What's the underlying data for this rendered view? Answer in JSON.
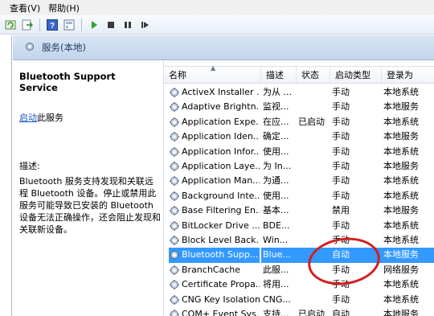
{
  "menu": {
    "items": [
      "查看(V)",
      "帮助(H)"
    ]
  },
  "toolbar": {
    "icons": [
      "refresh-icon",
      "export-icon",
      "help-icon",
      "properties-icon",
      "play-icon",
      "stop-icon",
      "pause-icon",
      "restart-icon"
    ]
  },
  "banner": {
    "title": "服务(本地)"
  },
  "description": {
    "service_name": "Bluetooth Support Service",
    "start_link": "启动",
    "start_suffix": "此服务",
    "desc_label": "描述:",
    "desc_text": "Bluetooth 服务支持发现和关联远程 Bluetooth 设备。停止或禁用此服务可能导致已安装的 Bluetooth 设备无法正确操作，还会阻止发现和关联新设备。"
  },
  "columns": {
    "name": "名称",
    "desc": "描述",
    "status": "状态",
    "start": "启动类型",
    "logon": "登录为"
  },
  "rows": [
    {
      "name": "ActiveX Installer ...",
      "desc": "为从 ...",
      "status": "",
      "start": "手动",
      "logon": "本地系统"
    },
    {
      "name": "Adaptive Brightn...",
      "desc": "监视...",
      "status": "",
      "start": "手动",
      "logon": "本地服务"
    },
    {
      "name": "Application Expe...",
      "desc": "在应...",
      "status": "已启动",
      "start": "手动",
      "logon": "本地系统"
    },
    {
      "name": "Application Iden...",
      "desc": "确定...",
      "status": "",
      "start": "手动",
      "logon": "本地服务"
    },
    {
      "name": "Application Infor...",
      "desc": "使用...",
      "status": "",
      "start": "手动",
      "logon": "本地系统"
    },
    {
      "name": "Application Laye...",
      "desc": "为 In...",
      "status": "",
      "start": "手动",
      "logon": "本地服务"
    },
    {
      "name": "Application Man...",
      "desc": "为通...",
      "status": "",
      "start": "手动",
      "logon": "本地系统"
    },
    {
      "name": "Background Inte...",
      "desc": "使用...",
      "status": "",
      "start": "手动",
      "logon": "本地系统"
    },
    {
      "name": "Base Filtering En...",
      "desc": "基本...",
      "status": "",
      "start": "禁用",
      "logon": "本地服务"
    },
    {
      "name": "BitLocker Drive ...",
      "desc": "BDE...",
      "status": "",
      "start": "手动",
      "logon": "本地系统"
    },
    {
      "name": "Block Level Back...",
      "desc": "Win...",
      "status": "",
      "start": "手动",
      "logon": "本地系统"
    },
    {
      "name": "Bluetooth Supp...",
      "desc": "Blue...",
      "status": "",
      "start": "自动",
      "logon": "本地服务",
      "selected": true
    },
    {
      "name": "BranchCache",
      "desc": "此服...",
      "status": "",
      "start": "手动",
      "logon": "网络服务"
    },
    {
      "name": "Certificate Propa...",
      "desc": "将用...",
      "status": "",
      "start": "手动",
      "logon": "本地系统"
    },
    {
      "name": "CNG Key Isolation",
      "desc": "CNG...",
      "status": "",
      "start": "手动",
      "logon": "本地系统"
    },
    {
      "name": "COM+ Event Sys...",
      "desc": "支持...",
      "status": "已启动",
      "start": "自动",
      "logon": "本地服务"
    }
  ],
  "colors": {
    "selection": "#3399ff",
    "link": "#1a54c9",
    "annotation": "#d21f1f"
  }
}
